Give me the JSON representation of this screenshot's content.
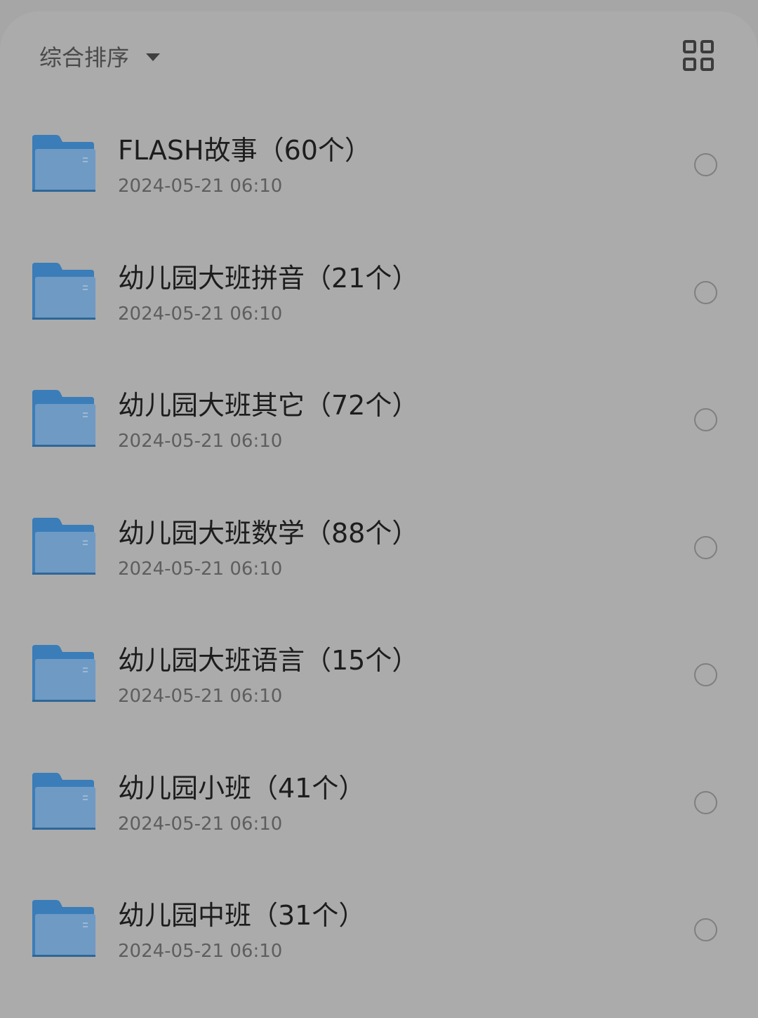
{
  "toolbar": {
    "sort_label": "综合排序",
    "sort_icon": "caret-down-icon",
    "view_toggle_icon": "grid-view-icon"
  },
  "colors": {
    "folder": "#3a7db8",
    "folder_front": "#6f9ac4",
    "background": "#ababab"
  },
  "folders": [
    {
      "name": "FLASH故事（60个）",
      "date": "2024-05-21 06:10"
    },
    {
      "name": "幼儿园大班拼音（21个）",
      "date": "2024-05-21 06:10"
    },
    {
      "name": "幼儿园大班其它（72个）",
      "date": "2024-05-21 06:10"
    },
    {
      "name": "幼儿园大班数学（88个）",
      "date": "2024-05-21 06:10"
    },
    {
      "name": "幼儿园大班语言（15个）",
      "date": "2024-05-21 06:10"
    },
    {
      "name": "幼儿园小班（41个）",
      "date": "2024-05-21 06:10"
    },
    {
      "name": "幼儿园中班（31个）",
      "date": "2024-05-21 06:10"
    }
  ]
}
